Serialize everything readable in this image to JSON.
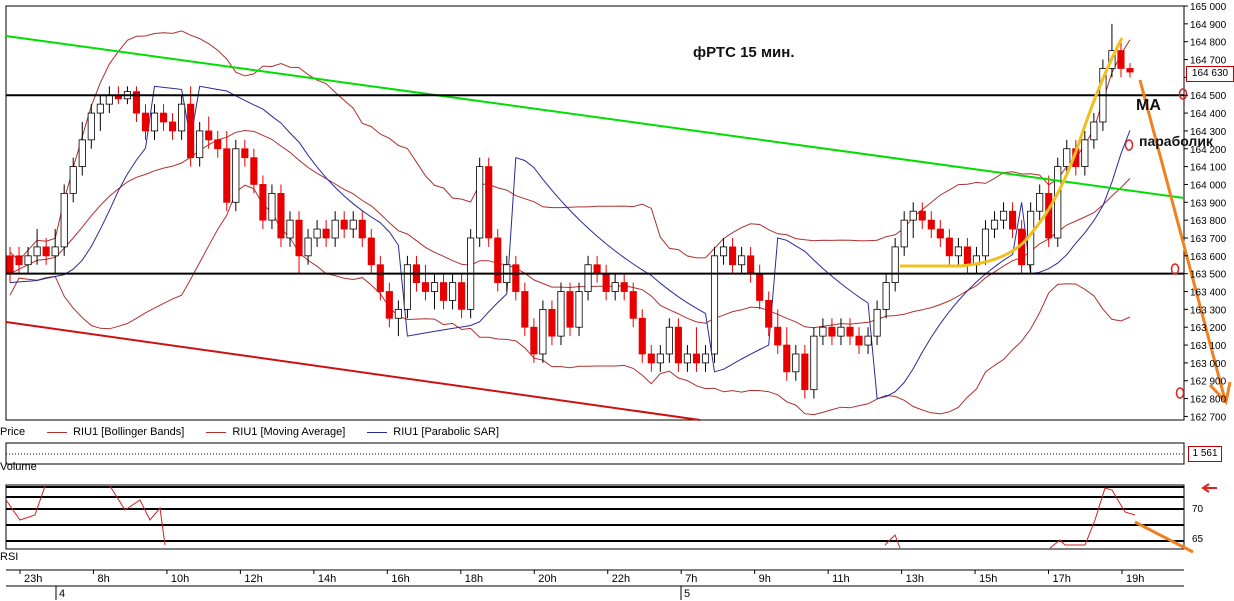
{
  "chart_data": {
    "type": "candlestick",
    "title": "фРТС   15 мин.",
    "annotations": [
      "МА",
      "параболик"
    ],
    "price_axis": {
      "ticks": [
        162700,
        162800,
        162900,
        163000,
        163100,
        163200,
        163300,
        163400,
        163500,
        163600,
        163700,
        163800,
        163900,
        164000,
        164100,
        164200,
        164300,
        164400,
        164500,
        164600,
        164700,
        164800,
        164900,
        165000
      ],
      "tick_labels": [
        "162 700",
        "162 800",
        "162 900",
        "163 000",
        "163 100",
        "163 200",
        "163 300",
        "163 400",
        "163 500",
        "163 600",
        "163 700",
        "163 800",
        "163 900",
        "164 000",
        "164 100",
        "164 200",
        "164 300",
        "164 400",
        "164 500",
        "164 600",
        "164 700",
        "164 800",
        "164 900",
        "165 000"
      ],
      "ylim": [
        162680,
        165000
      ],
      "last_price_label": "164 630"
    },
    "legend": [
      {
        "name": "Price",
        "color": "#000000"
      },
      {
        "name": "RIU1 [Bollinger Bands]",
        "color": "#b03030"
      },
      {
        "name": "RIU1 [Moving Average]",
        "color": "#b03030"
      },
      {
        "name": "RIU1 [Parabolic SAR]",
        "color": "#2a2a9a"
      }
    ],
    "x_axis": {
      "time_labels": [
        "23h",
        "8h",
        "10h",
        "12h",
        "14h",
        "16h",
        "18h",
        "20h",
        "22h",
        "7h",
        "9h",
        "11h",
        "13h",
        "15h",
        "17h",
        "19h"
      ],
      "day_labels": [
        "4",
        "5"
      ]
    },
    "candles_ohlc": [
      [
        163600,
        163650,
        163450,
        163500
      ],
      [
        163600,
        163650,
        163500,
        163550
      ],
      [
        163550,
        163650,
        163500,
        163600
      ],
      [
        163600,
        163750,
        163550,
        163650
      ],
      [
        163650,
        163700,
        163550,
        163600
      ],
      [
        163600,
        163750,
        163500,
        163650
      ],
      [
        163650,
        164000,
        163600,
        163950
      ],
      [
        163950,
        164150,
        163900,
        164100
      ],
      [
        164100,
        164350,
        164050,
        164250
      ],
      [
        164250,
        164450,
        164200,
        164400
      ],
      [
        164400,
        164500,
        164300,
        164450
      ],
      [
        164450,
        164550,
        164400,
        164500
      ],
      [
        164500,
        164550,
        164450,
        164480
      ],
      [
        164480,
        164550,
        164450,
        164520
      ],
      [
        164520,
        164550,
        164350,
        164400
      ],
      [
        164400,
        164450,
        164250,
        164300
      ],
      [
        164300,
        164450,
        164250,
        164400
      ],
      [
        164400,
        164450,
        164300,
        164350
      ],
      [
        164350,
        164400,
        164250,
        164300
      ],
      [
        164300,
        164500,
        164250,
        164450
      ],
      [
        164450,
        164550,
        164100,
        164150
      ],
      [
        164150,
        164350,
        164100,
        164300
      ],
      [
        164300,
        164380,
        164200,
        164250
      ],
      [
        164250,
        164300,
        164150,
        164200
      ],
      [
        164200,
        164300,
        163850,
        163900
      ],
      [
        163900,
        164250,
        163850,
        164200
      ],
      [
        164200,
        164250,
        164100,
        164150
      ],
      [
        164150,
        164200,
        163950,
        164000
      ],
      [
        164000,
        164050,
        163750,
        163800
      ],
      [
        163800,
        164000,
        163750,
        163950
      ],
      [
        163950,
        164000,
        163650,
        163700
      ],
      [
        163700,
        163850,
        163650,
        163800
      ],
      [
        163800,
        163850,
        163500,
        163600
      ],
      [
        163600,
        163750,
        163550,
        163700
      ],
      [
        163700,
        163800,
        163650,
        163750
      ],
      [
        163750,
        163800,
        163650,
        163700
      ],
      [
        163700,
        163850,
        163650,
        163800
      ],
      [
        163800,
        163850,
        163700,
        163750
      ],
      [
        163750,
        163850,
        163700,
        163800
      ],
      [
        163800,
        163850,
        163650,
        163700
      ],
      [
        163700,
        163750,
        163500,
        163550
      ],
      [
        163550,
        163600,
        163350,
        163400
      ],
      [
        163400,
        163450,
        163200,
        163250
      ],
      [
        163250,
        163350,
        163150,
        163300
      ],
      [
        163300,
        163600,
        163250,
        163550
      ],
      [
        163550,
        163600,
        163400,
        163450
      ],
      [
        163450,
        163550,
        163350,
        163400
      ],
      [
        163400,
        163500,
        163300,
        163450
      ],
      [
        163450,
        163500,
        163300,
        163350
      ],
      [
        163350,
        163500,
        163300,
        163450
      ],
      [
        163450,
        163500,
        163250,
        163300
      ],
      [
        163300,
        163750,
        163250,
        163700
      ],
      [
        163700,
        164150,
        163650,
        164100
      ],
      [
        164100,
        164150,
        163650,
        163700
      ],
      [
        163700,
        163750,
        163400,
        163450
      ],
      [
        163450,
        163600,
        163400,
        163550
      ],
      [
        163550,
        163600,
        163350,
        163400
      ],
      [
        163400,
        163450,
        163150,
        163200
      ],
      [
        163200,
        163250,
        163000,
        163050
      ],
      [
        163050,
        163350,
        163000,
        163300
      ],
      [
        163300,
        163350,
        163100,
        163150
      ],
      [
        163150,
        163450,
        163100,
        163400
      ],
      [
        163400,
        163450,
        163150,
        163200
      ],
      [
        163200,
        163450,
        163150,
        163400
      ],
      [
        163400,
        163600,
        163350,
        163550
      ],
      [
        163550,
        163600,
        163450,
        163500
      ],
      [
        163500,
        163550,
        163350,
        163400
      ],
      [
        163400,
        163500,
        163350,
        163450
      ],
      [
        163450,
        163500,
        163350,
        163400
      ],
      [
        163400,
        163450,
        163200,
        163250
      ],
      [
        163250,
        163300,
        163000,
        163050
      ],
      [
        163050,
        163100,
        162950,
        163000
      ],
      [
        163000,
        163100,
        162950,
        163050
      ],
      [
        163050,
        163250,
        163000,
        163200
      ],
      [
        163200,
        163250,
        162950,
        163000
      ],
      [
        163000,
        163100,
        162950,
        163050
      ],
      [
        163050,
        163200,
        162950,
        163000
      ],
      [
        163000,
        163100,
        162950,
        163050
      ],
      [
        163050,
        163650,
        163000,
        163600
      ],
      [
        163600,
        163700,
        163550,
        163650
      ],
      [
        163650,
        163700,
        163500,
        163550
      ],
      [
        163550,
        163650,
        163500,
        163600
      ],
      [
        163600,
        163650,
        163450,
        163500
      ],
      [
        163500,
        163550,
        163300,
        163350
      ],
      [
        163350,
        163400,
        163150,
        163200
      ],
      [
        163200,
        163300,
        163050,
        163100
      ],
      [
        163100,
        163200,
        162900,
        162950
      ],
      [
        162950,
        163100,
        162900,
        163050
      ],
      [
        163050,
        163100,
        162800,
        162850
      ],
      [
        162850,
        163200,
        162800,
        163150
      ],
      [
        163150,
        163250,
        163100,
        163200
      ],
      [
        163200,
        163250,
        163100,
        163150
      ],
      [
        163150,
        163250,
        163100,
        163200
      ],
      [
        163200,
        163250,
        163100,
        163150
      ],
      [
        163150,
        163200,
        163050,
        163100
      ],
      [
        163100,
        163200,
        163050,
        163150
      ],
      [
        163150,
        163350,
        163100,
        163300
      ],
      [
        163300,
        163500,
        163250,
        163450
      ],
      [
        163450,
        163700,
        163400,
        163650
      ],
      [
        163650,
        163850,
        163600,
        163800
      ],
      [
        163800,
        163900,
        163700,
        163850
      ],
      [
        163850,
        163900,
        163750,
        163800
      ],
      [
        163800,
        163850,
        163700,
        163750
      ],
      [
        163750,
        163800,
        163650,
        163700
      ],
      [
        163700,
        163750,
        163550,
        163600
      ],
      [
        163600,
        163700,
        163550,
        163650
      ],
      [
        163650,
        163700,
        163500,
        163550
      ],
      [
        163550,
        163650,
        163500,
        163600
      ],
      [
        163600,
        163800,
        163550,
        163750
      ],
      [
        163750,
        163850,
        163700,
        163800
      ],
      [
        163800,
        163900,
        163750,
        163850
      ],
      [
        163850,
        163900,
        163700,
        163750
      ],
      [
        163750,
        163800,
        163500,
        163550
      ],
      [
        163550,
        163900,
        163500,
        163850
      ],
      [
        163850,
        164000,
        163800,
        163950
      ],
      [
        163950,
        164050,
        163650,
        163700
      ],
      [
        163700,
        164150,
        163650,
        164100
      ],
      [
        164100,
        164250,
        164050,
        164200
      ],
      [
        164200,
        164250,
        164050,
        164100
      ],
      [
        164100,
        164300,
        164050,
        164250
      ],
      [
        164250,
        164400,
        164200,
        164350
      ],
      [
        164350,
        164700,
        164300,
        164650
      ],
      [
        164650,
        164900,
        164600,
        164750
      ],
      [
        164750,
        164800,
        164600,
        164650
      ],
      [
        164650,
        164680,
        164600,
        164630
      ]
    ],
    "rsi_axis": {
      "tick_labels": [
        "70",
        "65"
      ]
    }
  },
  "panels": {
    "volume_label": "Volume",
    "volume_value": "1 561",
    "rsi_label": "RSI"
  },
  "colors": {
    "bull": "#ffffff",
    "bear": "#e80000",
    "bollinger": "#b03030",
    "moving_average": "#b03030",
    "sar": "#2a2a9a",
    "trend_green": "#00dd00",
    "trend_red": "#cc1111",
    "hand_orange": "#f08020",
    "hand_yellow": "#f0c020"
  }
}
